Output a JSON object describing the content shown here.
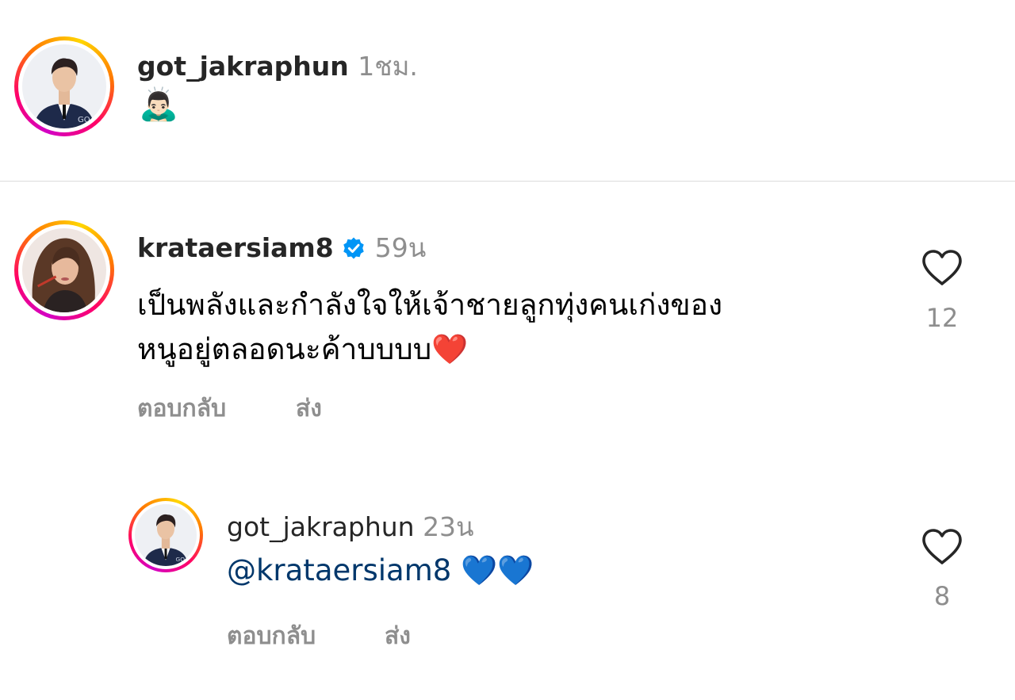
{
  "post": {
    "username": "got_jakraphun",
    "time": "1ชม.",
    "caption_emoji": "🙇🏻‍♂️"
  },
  "comments": [
    {
      "username": "krataersiam8",
      "verified": true,
      "time": "59น",
      "text_line1": "เป็นพลังและกำลังใจให้เจ้าชายลูกทุ่งคนเก่งของ",
      "text_line2": "หนูอยู่ตลอดนะค้าบบบบ",
      "text_emoji": "❤️",
      "reply_label": "ตอบกลับ",
      "send_label": "ส่ง",
      "like_count": "12"
    }
  ],
  "reply": {
    "username": "got_jakraphun",
    "time": "23น",
    "mention": "@krataersiam8",
    "text_emoji": "💙💙",
    "reply_label": "ตอบกลับ",
    "send_label": "ส่ง",
    "like_count": "8"
  },
  "colors": {
    "mention": "#00376b",
    "verified": "#0095f6",
    "heart_red": "#ed1c24",
    "heart_blue": "#1e73e8"
  }
}
